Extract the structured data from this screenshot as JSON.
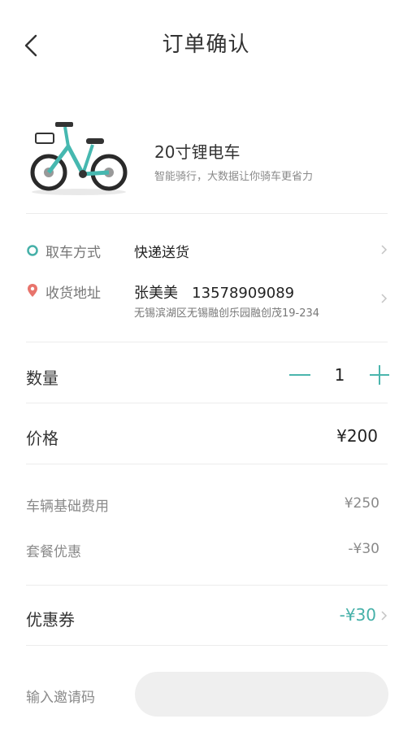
{
  "nav": {
    "title": "订单确认"
  },
  "product": {
    "name": "20寸锂电车",
    "desc": "智能骑行，大数据让你骑车更省力"
  },
  "pickup": {
    "label": "取车方式",
    "value": "快递送货"
  },
  "address": {
    "label": "收货地址",
    "name_phone": "张美美   13578909089",
    "detail": "无锡滨湖区无锡融创乐园融创茂19-234"
  },
  "quantity": {
    "label": "数量",
    "value": "1"
  },
  "price": {
    "label": "价格",
    "value": "¥200"
  },
  "fees": {
    "base_label": "车辆基础费用",
    "base_value": "¥250",
    "discount_label": "套餐优惠",
    "discount_value": "-¥30"
  },
  "coupon": {
    "label": "优惠券",
    "value": "-¥30"
  },
  "invite": {
    "label": "输入邀请码",
    "value": ""
  },
  "colors": {
    "accent": "#45b0a8",
    "location_pin": "#e8746c",
    "input_bg": "#efefef"
  },
  "icons": [
    "back-chevron-icon",
    "circle-icon",
    "location-pin-icon",
    "chevron-right-icon",
    "minus-icon",
    "plus-icon"
  ]
}
